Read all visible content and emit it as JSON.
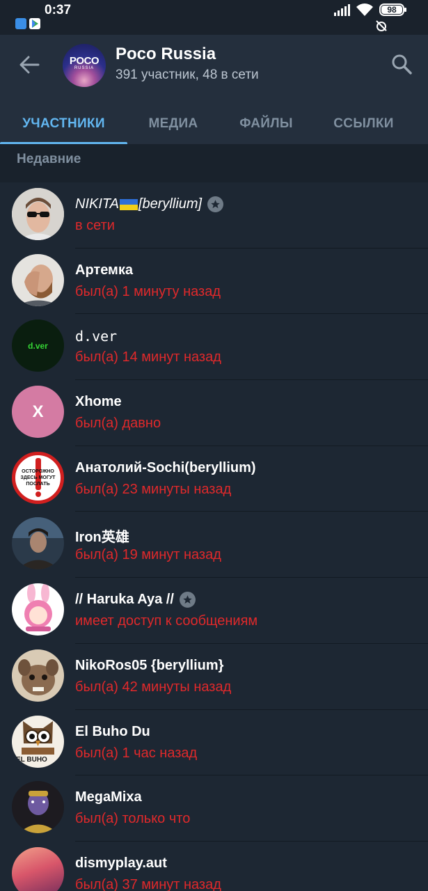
{
  "status_bar": {
    "time": "0:37",
    "battery": "98"
  },
  "header": {
    "avatar_brand": "POCO",
    "avatar_sub": "RUSSIA",
    "title": "Poco Russia",
    "subtitle": "391 участник, 48 в сети"
  },
  "tabs": [
    {
      "label": "УЧАСТНИКИ",
      "active": true
    },
    {
      "label": "МЕДИА",
      "active": false
    },
    {
      "label": "ФАЙЛЫ",
      "active": false
    },
    {
      "label": "ССЫЛКИ",
      "active": false
    }
  ],
  "section_label": "Недавние",
  "members": [
    {
      "name_pre": "NIKITA",
      "name_post": "[beryllium]",
      "status": "в сети",
      "has_star": true
    },
    {
      "name": "Артемка",
      "status": "был(а) 1 минуту назад"
    },
    {
      "name": "d.ver",
      "avatar_text": "d.ver",
      "status": "был(а) 14 минут назад"
    },
    {
      "name": "Xhome",
      "avatar_letter": "X",
      "status": "был(а) давно"
    },
    {
      "name": "Анатолий-Sochi(beryllium)",
      "avatar_text": "ОСТОРОЖНО ЗДЕСЬ МОГУТ ПОСЛАТЬ",
      "status": "был(а) 23 минуты назад"
    },
    {
      "name": "Iron英雄",
      "status": "был(а) 19 минут назад"
    },
    {
      "name": "// Haruka Aya //",
      "status": "имеет доступ к сообщениям",
      "has_star": true
    },
    {
      "name": "NikoRos05 {beryllium}",
      "status": "был(а) 42 минуты назад"
    },
    {
      "name": "El Buho Du",
      "avatar_text": "EL BUHO",
      "status": "был(а) 1 час назад"
    },
    {
      "name": "MegaMixa",
      "status": "был(а) только что"
    },
    {
      "name": "dismyplay.aut",
      "status": "был(а) 37 минут назад"
    }
  ],
  "colors": {
    "accent": "#62b6f0",
    "status_red": "#e0292b",
    "header_bg": "#242f3d",
    "list_bg": "#1d2733"
  }
}
